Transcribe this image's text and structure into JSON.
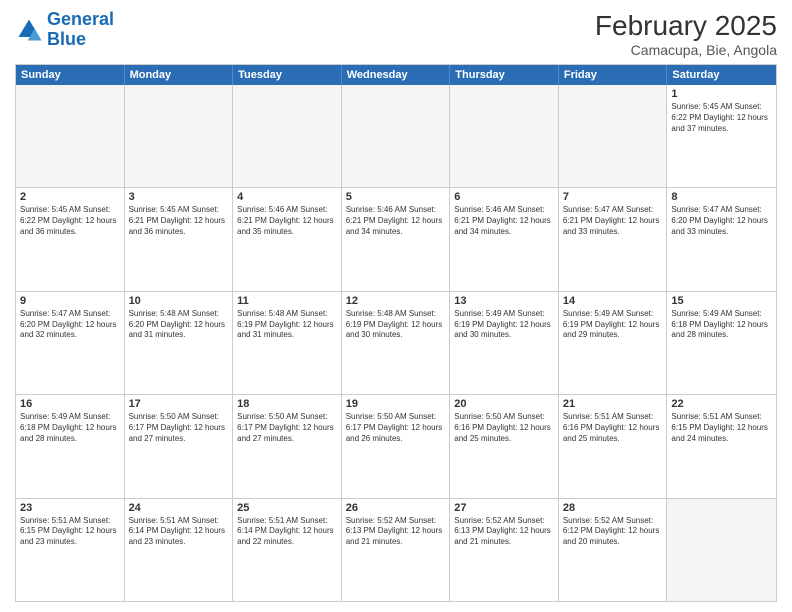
{
  "logo": {
    "line1": "General",
    "line2": "Blue"
  },
  "header": {
    "month_year": "February 2025",
    "location": "Camacupa, Bie, Angola"
  },
  "days_of_week": [
    "Sunday",
    "Monday",
    "Tuesday",
    "Wednesday",
    "Thursday",
    "Friday",
    "Saturday"
  ],
  "weeks": [
    [
      {
        "day": "",
        "text": ""
      },
      {
        "day": "",
        "text": ""
      },
      {
        "day": "",
        "text": ""
      },
      {
        "day": "",
        "text": ""
      },
      {
        "day": "",
        "text": ""
      },
      {
        "day": "",
        "text": ""
      },
      {
        "day": "1",
        "text": "Sunrise: 5:45 AM\nSunset: 6:22 PM\nDaylight: 12 hours and 37 minutes."
      }
    ],
    [
      {
        "day": "2",
        "text": "Sunrise: 5:45 AM\nSunset: 6:22 PM\nDaylight: 12 hours and 36 minutes."
      },
      {
        "day": "3",
        "text": "Sunrise: 5:45 AM\nSunset: 6:21 PM\nDaylight: 12 hours and 36 minutes."
      },
      {
        "day": "4",
        "text": "Sunrise: 5:46 AM\nSunset: 6:21 PM\nDaylight: 12 hours and 35 minutes."
      },
      {
        "day": "5",
        "text": "Sunrise: 5:46 AM\nSunset: 6:21 PM\nDaylight: 12 hours and 34 minutes."
      },
      {
        "day": "6",
        "text": "Sunrise: 5:46 AM\nSunset: 6:21 PM\nDaylight: 12 hours and 34 minutes."
      },
      {
        "day": "7",
        "text": "Sunrise: 5:47 AM\nSunset: 6:21 PM\nDaylight: 12 hours and 33 minutes."
      },
      {
        "day": "8",
        "text": "Sunrise: 5:47 AM\nSunset: 6:20 PM\nDaylight: 12 hours and 33 minutes."
      }
    ],
    [
      {
        "day": "9",
        "text": "Sunrise: 5:47 AM\nSunset: 6:20 PM\nDaylight: 12 hours and 32 minutes."
      },
      {
        "day": "10",
        "text": "Sunrise: 5:48 AM\nSunset: 6:20 PM\nDaylight: 12 hours and 31 minutes."
      },
      {
        "day": "11",
        "text": "Sunrise: 5:48 AM\nSunset: 6:19 PM\nDaylight: 12 hours and 31 minutes."
      },
      {
        "day": "12",
        "text": "Sunrise: 5:48 AM\nSunset: 6:19 PM\nDaylight: 12 hours and 30 minutes."
      },
      {
        "day": "13",
        "text": "Sunrise: 5:49 AM\nSunset: 6:19 PM\nDaylight: 12 hours and 30 minutes."
      },
      {
        "day": "14",
        "text": "Sunrise: 5:49 AM\nSunset: 6:19 PM\nDaylight: 12 hours and 29 minutes."
      },
      {
        "day": "15",
        "text": "Sunrise: 5:49 AM\nSunset: 6:18 PM\nDaylight: 12 hours and 28 minutes."
      }
    ],
    [
      {
        "day": "16",
        "text": "Sunrise: 5:49 AM\nSunset: 6:18 PM\nDaylight: 12 hours and 28 minutes."
      },
      {
        "day": "17",
        "text": "Sunrise: 5:50 AM\nSunset: 6:17 PM\nDaylight: 12 hours and 27 minutes."
      },
      {
        "day": "18",
        "text": "Sunrise: 5:50 AM\nSunset: 6:17 PM\nDaylight: 12 hours and 27 minutes."
      },
      {
        "day": "19",
        "text": "Sunrise: 5:50 AM\nSunset: 6:17 PM\nDaylight: 12 hours and 26 minutes."
      },
      {
        "day": "20",
        "text": "Sunrise: 5:50 AM\nSunset: 6:16 PM\nDaylight: 12 hours and 25 minutes."
      },
      {
        "day": "21",
        "text": "Sunrise: 5:51 AM\nSunset: 6:16 PM\nDaylight: 12 hours and 25 minutes."
      },
      {
        "day": "22",
        "text": "Sunrise: 5:51 AM\nSunset: 6:15 PM\nDaylight: 12 hours and 24 minutes."
      }
    ],
    [
      {
        "day": "23",
        "text": "Sunrise: 5:51 AM\nSunset: 6:15 PM\nDaylight: 12 hours and 23 minutes."
      },
      {
        "day": "24",
        "text": "Sunrise: 5:51 AM\nSunset: 6:14 PM\nDaylight: 12 hours and 23 minutes."
      },
      {
        "day": "25",
        "text": "Sunrise: 5:51 AM\nSunset: 6:14 PM\nDaylight: 12 hours and 22 minutes."
      },
      {
        "day": "26",
        "text": "Sunrise: 5:52 AM\nSunset: 6:13 PM\nDaylight: 12 hours and 21 minutes."
      },
      {
        "day": "27",
        "text": "Sunrise: 5:52 AM\nSunset: 6:13 PM\nDaylight: 12 hours and 21 minutes."
      },
      {
        "day": "28",
        "text": "Sunrise: 5:52 AM\nSunset: 6:12 PM\nDaylight: 12 hours and 20 minutes."
      },
      {
        "day": "",
        "text": ""
      }
    ]
  ]
}
